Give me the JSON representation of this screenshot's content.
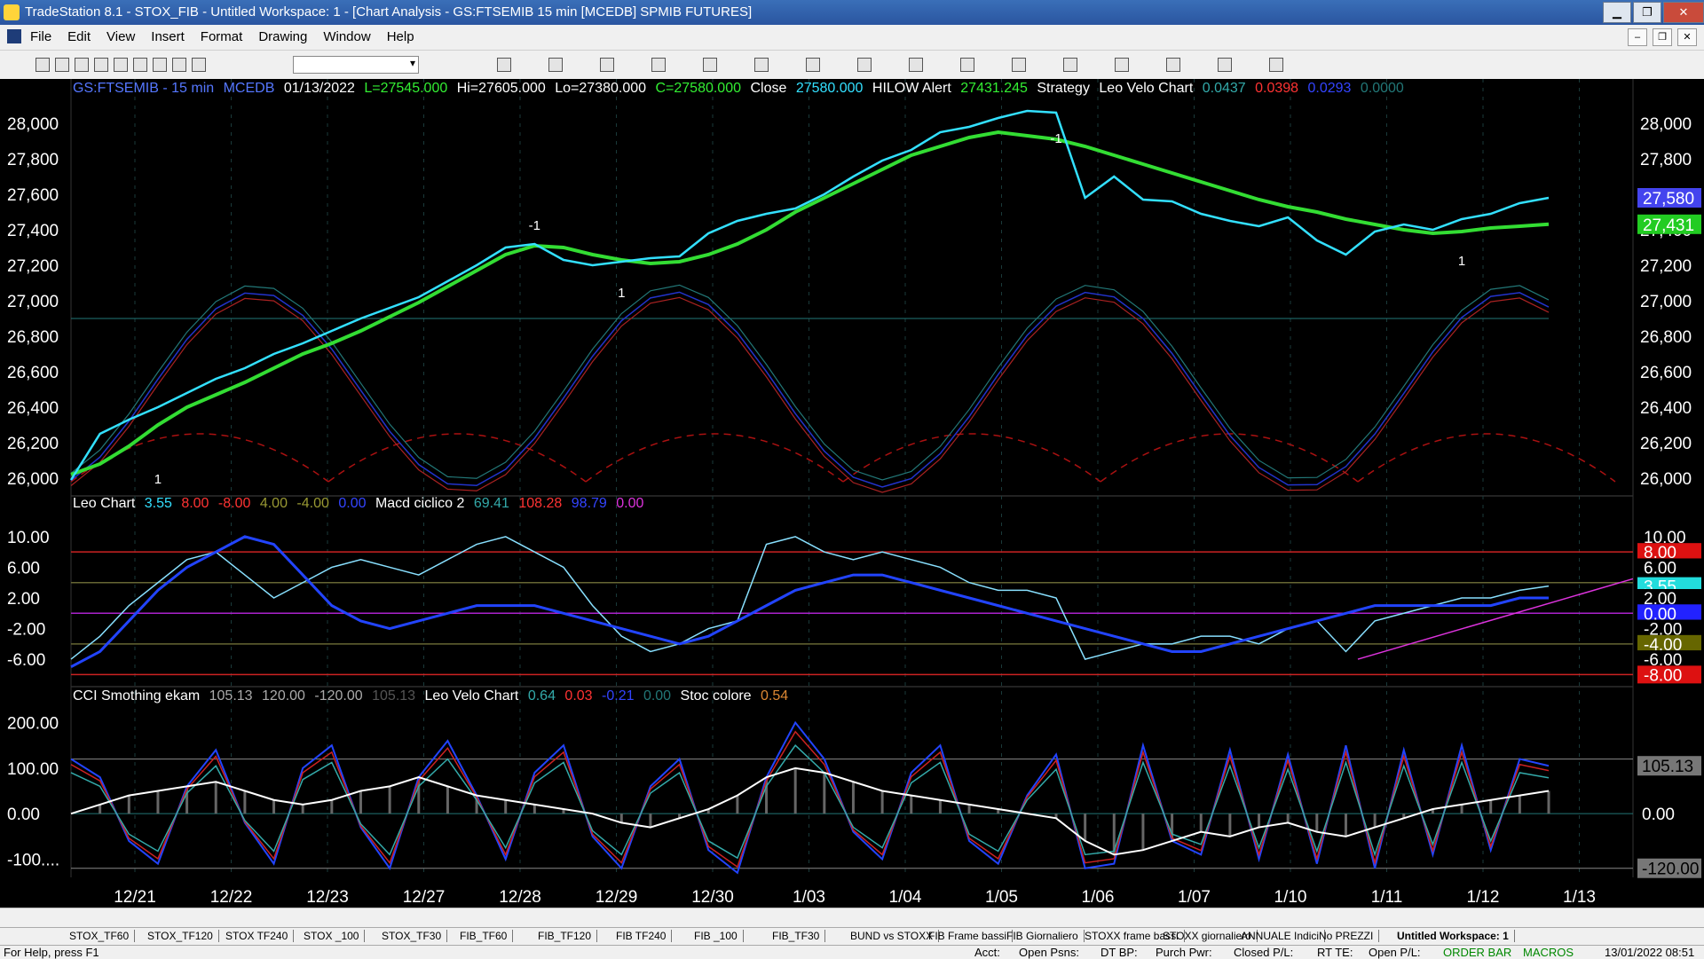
{
  "window": {
    "title": "TradeStation 8.1 - STOX_FIB - Untitled Workspace:  1 - [Chart Analysis - GS:FTSEMIB  15 min  [MCEDB] SPMIB FUTURES]",
    "min_label": "▁",
    "max_label": "❐",
    "close_label": "✕"
  },
  "menu": {
    "items": [
      "File",
      "Edit",
      "View",
      "Insert",
      "Format",
      "Drawing",
      "Window",
      "Help"
    ],
    "mdi": [
      "–",
      "❐",
      "✕"
    ]
  },
  "chart_header": {
    "symbol": "GS:FTSEMIB - 15 min",
    "source": "MCEDB",
    "date": "01/13/2022",
    "last": "L=27545.000",
    "high": "Hi=27605.000",
    "low": "Lo=27380.000",
    "close": "C=27580.000",
    "close_label": "Close",
    "close_value": "27580.000",
    "hilow": "HILOW Alert",
    "hilow_value": "27431.245",
    "strategy": "Strategy",
    "velo": "Leo Velo Chart",
    "v1": "0.0437",
    "v2": "0.0398",
    "v3": "0.0293",
    "v4": "0.0000"
  },
  "panel2_header": {
    "name": "Leo Chart",
    "a": "3.55",
    "b": "8.00",
    "c": "-8.00",
    "d": "4.00",
    "e": "-4.00",
    "f": "0.00",
    "macd": "Macd ciclico 2",
    "m1": "69.41",
    "m2": "108.28",
    "m3": "98.79",
    "m4": "0.00"
  },
  "panel3_header": {
    "name": "CCI Smothing ekam",
    "a": "105.13",
    "b": "120.00",
    "c": "-120.00",
    "d": "105.13",
    "velo": "Leo Velo Chart",
    "v1": "0.64",
    "v2": "0.03",
    "v3": "-0.21",
    "v4": "0.00",
    "stoc": "Stoc colore",
    "s1": "0.54"
  },
  "colors": {
    "price": "#33e0ff",
    "ma_green": "#33dd33",
    "ma_red": "#ff2222",
    "osc_blue": "#2244ff",
    "osc_red": "#cc2222",
    "osc_teal": "#339999",
    "magenta": "#dd33dd"
  },
  "chart_data": [
    {
      "type": "line",
      "panel": "price",
      "ylim": [
        25900,
        28200
      ],
      "y_ticks": [
        "28,000",
        "27,800",
        "27,600",
        "27,400",
        "27,200",
        "27,000",
        "26,800",
        "26,600",
        "26,400",
        "26,200",
        "26,000"
      ],
      "x_ticks": [
        "12/21",
        "12/22",
        "12/23",
        "12/27",
        "12/28",
        "12/29",
        "12/30",
        "1/03",
        "1/04",
        "1/05",
        "1/06",
        "1/07",
        "1/10",
        "1/11",
        "1/12",
        "1/13"
      ],
      "series": [
        {
          "values": [
            25990,
            26250,
            26330,
            26400,
            26480,
            26560,
            26620,
            26700,
            26760,
            26830,
            26900,
            26960,
            27020,
            27110,
            27200,
            27300,
            27320,
            27230,
            27200,
            27220,
            27240,
            27250,
            27380,
            27450,
            27490,
            27520,
            27600,
            27700,
            27790,
            27850,
            27950,
            27980,
            28030,
            28070,
            28060,
            27580,
            27700,
            27570,
            27560,
            27490,
            27450,
            27420,
            27470,
            27340,
            27260,
            27390,
            27430,
            27400,
            27460,
            27490,
            27550,
            27580
          ]
        },
        {
          "values": [
            26020,
            26080,
            26180,
            26300,
            26400,
            26470,
            26540,
            26620,
            26700,
            26760,
            26830,
            26910,
            26990,
            27080,
            27170,
            27260,
            27310,
            27300,
            27260,
            27230,
            27210,
            27220,
            27260,
            27320,
            27400,
            27500,
            27580,
            27660,
            27740,
            27820,
            27870,
            27920,
            27950,
            27930,
            27910,
            27870,
            27820,
            27770,
            27720,
            27670,
            27620,
            27570,
            27530,
            27500,
            27460,
            27430,
            27400,
            27380,
            27390,
            27410,
            27420,
            27431
          ]
        }
      ],
      "markers": [
        "1",
        "-1",
        "1",
        "-1",
        "1"
      ],
      "price_tags": [
        "27,580",
        "27,431"
      ]
    },
    {
      "type": "line",
      "panel": "oscillator",
      "ylim": [
        -9,
        13
      ],
      "y_ticks": [
        "10.00",
        "6.00",
        "2.00",
        "-2.00",
        "-6.00"
      ],
      "right_tags": [
        "10.00",
        "8.00",
        "6.00",
        "3.55",
        "2.00",
        "0.00",
        "-2.00",
        "-4.00",
        "-6.00",
        "-8.00"
      ],
      "series": [
        {
          "values": [
            -6,
            -3,
            1,
            4,
            7,
            8,
            5,
            2,
            4,
            6,
            7,
            6,
            5,
            7,
            9,
            10,
            8,
            6,
            1,
            -3,
            -5,
            -4,
            -2,
            -1,
            9,
            10,
            8,
            7,
            8,
            7,
            6,
            4,
            3,
            3,
            2,
            -6,
            -5,
            -4,
            -4,
            -3,
            -3,
            -4,
            -2,
            -1,
            -5,
            -1,
            0,
            1,
            2,
            2,
            3,
            3.55
          ]
        },
        {
          "values": [
            -7,
            -5,
            -1,
            3,
            6,
            8,
            10,
            9,
            5,
            1,
            -1,
            -2,
            -1,
            0,
            1,
            1,
            1,
            0,
            -1,
            -2,
            -3,
            -4,
            -3,
            -1,
            1,
            3,
            4,
            5,
            5,
            4,
            3,
            2,
            1,
            0,
            -1,
            -2,
            -3,
            -4,
            -5,
            -5,
            -4,
            -3,
            -2,
            -1,
            0,
            1,
            1,
            1,
            1,
            1,
            2,
            2
          ]
        }
      ]
    },
    {
      "type": "line",
      "panel": "cci",
      "ylim": [
        -140,
        240
      ],
      "y_ticks": [
        "200.00",
        "100.00",
        "0.00",
        "-100...."
      ],
      "right_tags": [
        "105.13",
        "0.00",
        "-120.00"
      ],
      "series": [
        {
          "values": [
            120,
            80,
            -60,
            -110,
            60,
            140,
            -20,
            -110,
            100,
            150,
            -30,
            -120,
            80,
            160,
            40,
            -100,
            90,
            150,
            -50,
            -120,
            60,
            120,
            -80,
            -130,
            80,
            200,
            120,
            -40,
            -100,
            90,
            150,
            -60,
            -110,
            40,
            130,
            -120,
            -110,
            150,
            -60,
            -90,
            140,
            -100,
            130,
            -110,
            150,
            -120,
            140,
            -90,
            150,
            -80,
            120,
            105
          ]
        },
        {
          "values": [
            0,
            20,
            40,
            50,
            60,
            70,
            50,
            30,
            20,
            30,
            50,
            60,
            80,
            60,
            40,
            30,
            20,
            10,
            0,
            -20,
            -30,
            -10,
            10,
            40,
            80,
            100,
            90,
            70,
            50,
            40,
            30,
            20,
            10,
            0,
            -10,
            -60,
            -90,
            -80,
            -60,
            -40,
            -50,
            -30,
            -20,
            -40,
            -50,
            -30,
            -10,
            10,
            20,
            30,
            40,
            50
          ]
        }
      ]
    }
  ],
  "status": {
    "help": "For Help, press F1",
    "acct": "Acct:",
    "psns": "Open Psns:",
    "dtbp": "DT BP:",
    "purch": "Purch Pwr:",
    "closed": "Closed P/L:",
    "rte": "RT TE:",
    "openpl": "Open P/L:",
    "orderbar": "ORDER BAR",
    "macros": "MACROS",
    "datetime": "13/01/2022 08:51"
  },
  "tabs": [
    "STOX_TF60",
    "STOX_TF120",
    "STOX TF240",
    "STOX _100",
    "STOX_TF30",
    "FIB_TF60",
    "FIB_TF120",
    "FIB TF240",
    "FIB _100",
    "FIB_TF30",
    "BUND vs STOXX",
    "FIB Frame bassi",
    "FIB Giornaliero",
    "STOXX frame bassi",
    "STOXX giornaliero",
    "ANNUALE Indici",
    "No PREZZI",
    "Untitled Workspace:  1"
  ]
}
